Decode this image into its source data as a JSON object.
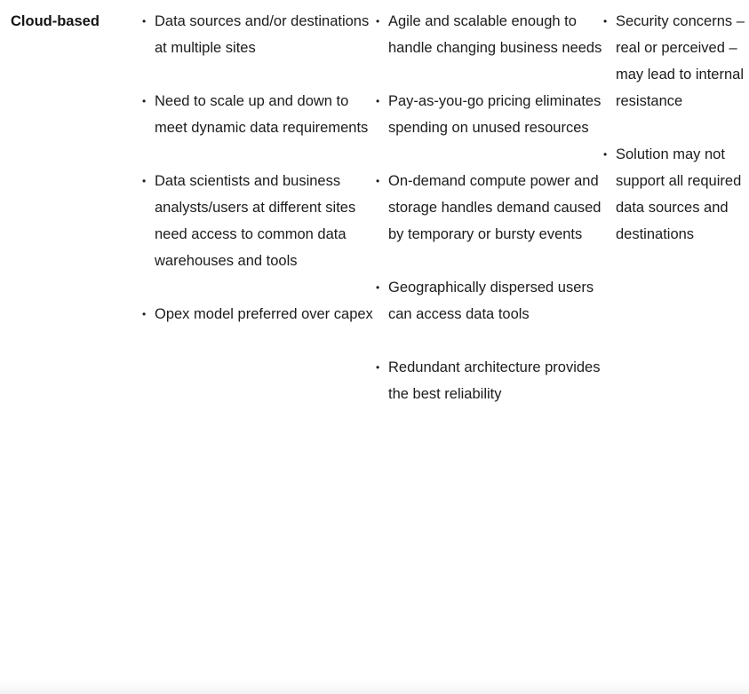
{
  "table": {
    "row": {
      "label": "Cloud-based",
      "columns": [
        {
          "name": "business-requirements",
          "items": [
            "Data sources and/or destinations at multiple sites",
            "Need to scale up and down to meet dynamic data requirements",
            "Data scientists and business analysts/users at different sites need access to common data warehouses and tools",
            "Opex model preferred over capex"
          ]
        },
        {
          "name": "benefits",
          "items": [
            "Agile and scalable enough to handle changing business needs",
            "Pay-as-you-go pricing eliminates spending on unused resources",
            "On-demand compute power and storage handles demand caused by temporary or bursty events",
            "Geographically dispersed users can access data tools",
            "Redundant architecture provides the best reliability"
          ]
        },
        {
          "name": "concerns",
          "items": [
            "Security concerns – real or perceived – may lead to internal resistance",
            "Solution may not support all required data sources and destinations"
          ]
        }
      ]
    }
  },
  "colors": {
    "text": "#1c1c1c",
    "label_text": "#141414",
    "background": "#ffffff",
    "bottom_edge": "#f3f3f3"
  }
}
